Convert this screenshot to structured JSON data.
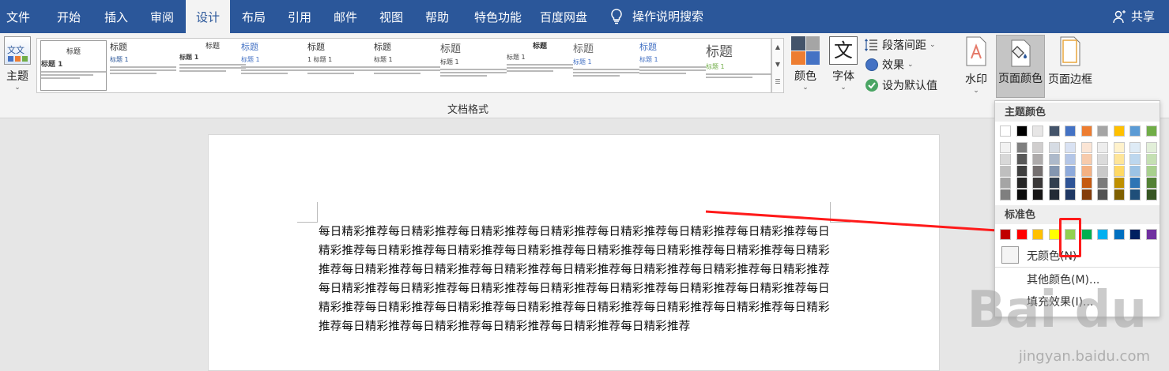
{
  "tabs": [
    "文件",
    "开始",
    "插入",
    "审阅",
    "设计",
    "布局",
    "引用",
    "邮件",
    "视图",
    "帮助",
    "特色功能",
    "百度网盘"
  ],
  "active_tab": "设计",
  "tell_me": "操作说明搜索",
  "share_label": "共享",
  "ribbon": {
    "theme_label": "主题",
    "gallery_group_label": "文档格式",
    "colors_label": "颜色",
    "fonts_label": "字体",
    "paragraph_spacing_label": "段落间距",
    "effects_label": "效果",
    "set_default_label": "设为默认值",
    "watermark_label": "水印",
    "page_color_label": "页面颜色",
    "page_borders_label": "页面边框",
    "fonts_icon_glyph": "文",
    "theme_icon_glyph": "文文"
  },
  "gallery": [
    {
      "title": "标题",
      "heading": "标题 1"
    },
    {
      "title": "标题",
      "heading": "标题 1"
    },
    {
      "title": "标题",
      "heading": "标题 1"
    },
    {
      "title": "标题",
      "heading": "标题 1"
    },
    {
      "title": "标题",
      "heading": "1 标题 1"
    },
    {
      "title": "标题",
      "heading": "标题 1"
    },
    {
      "title": "标题",
      "heading": "标题 1"
    },
    {
      "title": "标题",
      "heading": "标题 1"
    },
    {
      "title": "标题",
      "heading": "标题 1"
    },
    {
      "title": "标题",
      "heading": "标题 1"
    }
  ],
  "dropdown": {
    "theme_colors_header": "主题颜色",
    "standard_colors_header": "标准色",
    "no_color": "无颜色(N)",
    "more_colors": "其他颜色(M)...",
    "fill_effects": "填充效果(I)...",
    "theme_top_row": [
      "#ffffff",
      "#000000",
      "#e7e6e6",
      "#44546a",
      "#4472c4",
      "#ed7d31",
      "#a5a5a5",
      "#ffc000",
      "#5b9bd5",
      "#70ad47"
    ],
    "theme_shades": [
      [
        "#f2f2f2",
        "#7f7f7f",
        "#d0cece",
        "#d6dce4",
        "#d9e2f3",
        "#fbe5d5",
        "#ededed",
        "#fff2cc",
        "#deebf6",
        "#e2efd9"
      ],
      [
        "#d8d8d8",
        "#595959",
        "#aeabab",
        "#adb9ca",
        "#b4c6e7",
        "#f7cbac",
        "#dbdbdb",
        "#fee599",
        "#bdd7ee",
        "#c5e0b3"
      ],
      [
        "#bfbfbf",
        "#3f3f3f",
        "#757070",
        "#8496b0",
        "#8eaadb",
        "#f4b183",
        "#c9c9c9",
        "#ffd965",
        "#9cc3e5",
        "#a8d08d"
      ],
      [
        "#a5a5a5",
        "#262626",
        "#3a3838",
        "#323f4f",
        "#2f5496",
        "#c55a11",
        "#7b7b7b",
        "#bf9000",
        "#2e75b5",
        "#538135"
      ],
      [
        "#7f7f7f",
        "#0c0c0c",
        "#171616",
        "#222a35",
        "#1f3864",
        "#833c0b",
        "#525252",
        "#7f6000",
        "#1f4e79",
        "#375623"
      ]
    ],
    "standard_row": [
      "#c00000",
      "#ff0000",
      "#ffc000",
      "#ffff00",
      "#92d050",
      "#00b050",
      "#00b0f0",
      "#0070c0",
      "#002060",
      "#7030a0"
    ]
  },
  "document_text": "每日精彩推荐每日精彩推荐每日精彩推荐每日精彩推荐每日精彩推荐每日精彩推荐每日精彩推荐每日精彩推荐每日精彩推荐每日精彩推荐每日精彩推荐每日精彩推荐每日精彩推荐每日精彩推荐每日精彩推荐每日精彩推荐每日精彩推荐每日精彩推荐每日精彩推荐每日精彩推荐每日精彩推荐每日精彩推荐每日精彩推荐每日精彩推荐每日精彩推荐每日精彩推荐每日精彩推荐每日精彩推荐每日精彩推荐每日精彩推荐每日精彩推荐每日精彩推荐每日精彩推荐每日精彩推荐每日精彩推荐每日精彩推荐每日精彩推荐每日精彩推荐每日精彩推荐每日精彩推荐每日精彩推荐每日精彩推荐",
  "watermark_text": "Bai du",
  "watermark_url": "jingyan.baidu.com",
  "colors": {
    "ribbon_blue": "#2b579a",
    "annotation_red": "#ff1a1a"
  }
}
